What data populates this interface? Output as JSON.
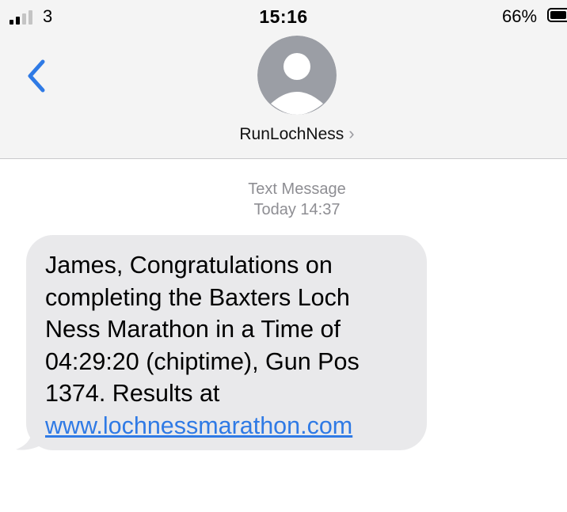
{
  "status_bar": {
    "carrier": "3",
    "time": "15:16",
    "battery_percent": "66%",
    "battery_level": 0.66,
    "signal_bars_filled": 2,
    "signal_bars_total": 4
  },
  "header": {
    "contact_name": "RunLochNess",
    "chevron": "›",
    "icons": [
      "back-chevron-icon",
      "default-avatar-icon",
      "chevron-right-icon"
    ]
  },
  "thread": {
    "meta_line1": "Text Message",
    "meta_line2": "Today 14:37"
  },
  "message": {
    "lines": [
      "James, Congratulations on",
      "completing the Baxters Loch",
      "Ness Marathon in a Time of",
      "04:29:20 (chiptime), Gun Pos",
      "1374. Results at"
    ],
    "link_text": "www.lochnessmarathon.com"
  },
  "colors": {
    "header_bg": "#f4f4f4",
    "bubble_bg": "#e9e9eb",
    "accent_blue": "#2f7ae5",
    "meta_gray": "#8e8e93",
    "avatar_gray": "#9b9ea5"
  }
}
